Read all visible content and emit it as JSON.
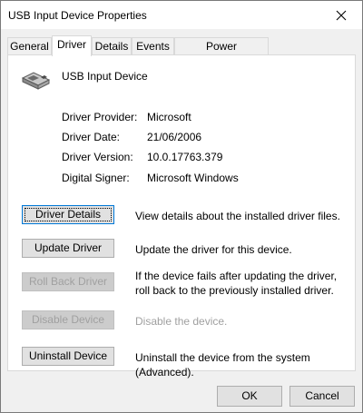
{
  "window": {
    "title": "USB Input Device Properties"
  },
  "tabs": [
    {
      "label": "General",
      "active": false
    },
    {
      "label": "Driver",
      "active": true
    },
    {
      "label": "Details",
      "active": false
    },
    {
      "label": "Events",
      "active": false
    },
    {
      "label": "Power Management",
      "active": false
    }
  ],
  "device": {
    "name": "USB Input Device",
    "icon": "usb-device-icon"
  },
  "properties": [
    {
      "label": "Driver Provider:",
      "value": "Microsoft"
    },
    {
      "label": "Driver Date:",
      "value": "21/06/2006"
    },
    {
      "label": "Driver Version:",
      "value": "10.0.17763.379"
    },
    {
      "label": "Digital Signer:",
      "value": "Microsoft Windows"
    }
  ],
  "actions": [
    {
      "label": "Driver Details",
      "description": "View details about the installed driver files.",
      "enabled": true,
      "focused": true
    },
    {
      "label": "Update Driver",
      "description": "Update the driver for this device.",
      "enabled": true,
      "focused": false
    },
    {
      "label": "Roll Back Driver",
      "description": "If the device fails after updating the driver, roll back to the previously installed driver.",
      "enabled": false,
      "focused": false
    },
    {
      "label": "Disable Device",
      "description": "Disable the device.",
      "enabled": false,
      "focused": false
    },
    {
      "label": "Uninstall Device",
      "description": "Uninstall the device from the system (Advanced).",
      "enabled": true,
      "focused": false
    }
  ],
  "footer": {
    "ok_label": "OK",
    "cancel_label": "Cancel"
  },
  "colors": {
    "focus_border": "#0078d7",
    "disabled_text": "#a0a0a0"
  }
}
